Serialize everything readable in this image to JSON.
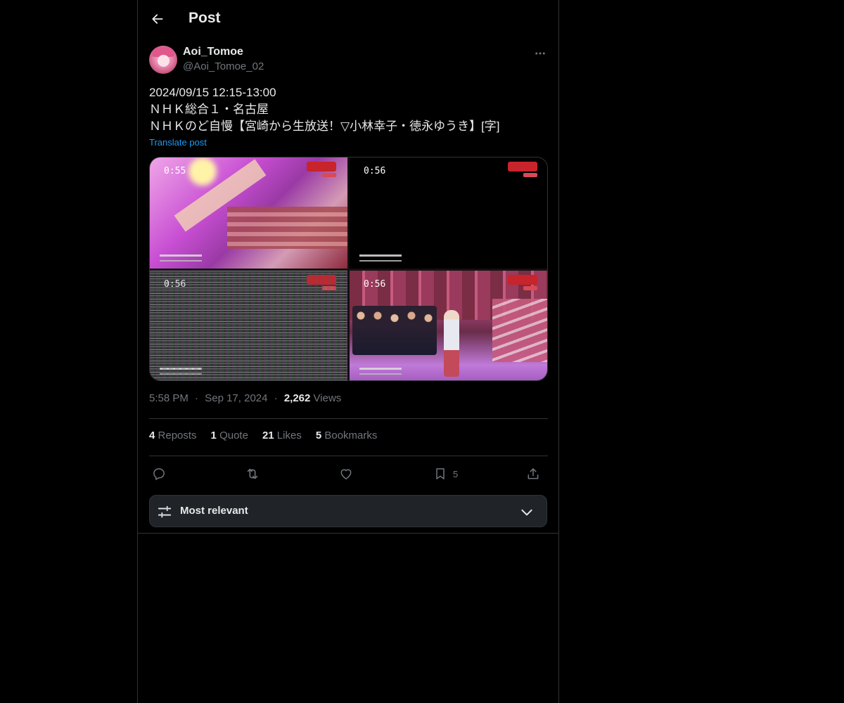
{
  "header": {
    "title": "Post",
    "back_icon": "arrow-left-icon"
  },
  "author": {
    "display_name": "Aoi_Tomoe",
    "handle": "@Aoi_Tomoe_02",
    "more_icon": "more-horizontal-icon"
  },
  "post": {
    "text": "2024/09/15 12:15-13:00\nＮＨＫ総合１・名古屋\nＮＨＫのど自慢【宮崎から生放送！▽小林幸子・徳永ゆうき】[字]",
    "translate_label": "Translate post"
  },
  "media": {
    "tiles": [
      {
        "time": "0:55"
      },
      {
        "time": "0:56"
      },
      {
        "time": "0:56"
      },
      {
        "time": "0:56"
      }
    ]
  },
  "meta": {
    "time": "5:58 PM",
    "separator": "·",
    "date": "Sep 17, 2024",
    "views_count": "2,262",
    "views_label": "Views"
  },
  "stats": {
    "reposts_count": "4",
    "reposts_label": "Reposts",
    "quote_count": "1",
    "quote_label": "Quote",
    "likes_count": "21",
    "likes_label": "Likes",
    "bookmarks_count": "5",
    "bookmarks_label": "Bookmarks"
  },
  "actions": {
    "reply_icon": "reply-icon",
    "repost_icon": "repost-icon",
    "like_icon": "heart-icon",
    "bookmark_icon": "bookmark-icon",
    "bookmark_count": "5",
    "share_icon": "share-icon"
  },
  "sort": {
    "label": "Most relevant",
    "icon": "sliders-icon",
    "chevron": "chevron-down-icon"
  },
  "colors": {
    "background": "#000000",
    "text": "#e7e9ea",
    "muted": "#71767b",
    "link": "#1d9bf0",
    "border": "#2f3336",
    "sort_bg": "#202327"
  }
}
